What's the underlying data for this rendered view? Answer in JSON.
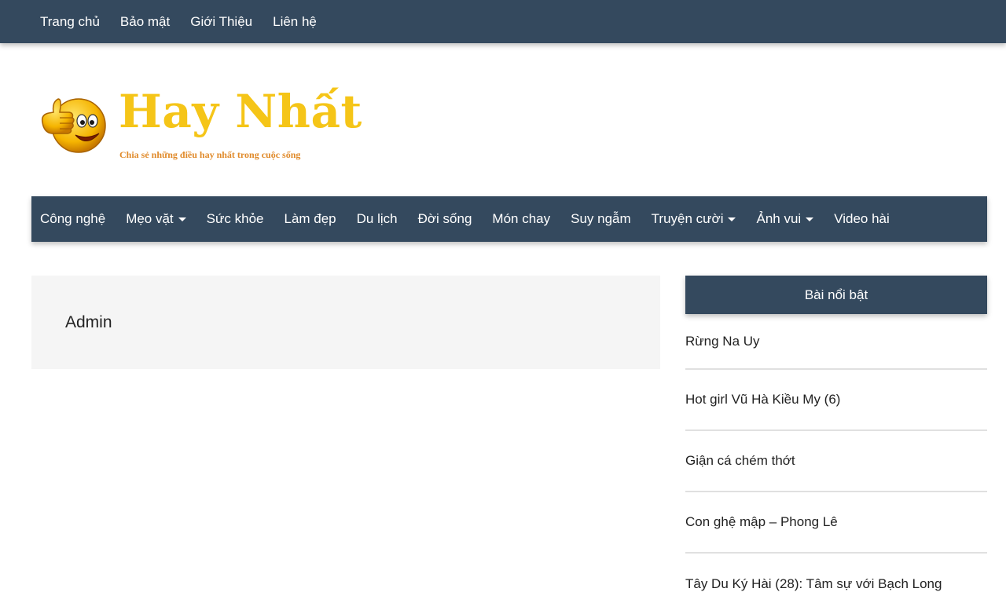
{
  "top_menu": {
    "items": [
      {
        "label": "Trang chủ"
      },
      {
        "label": "Bảo mật"
      },
      {
        "label": "Giới Thiệu"
      },
      {
        "label": "Liên hệ"
      }
    ]
  },
  "logo": {
    "brand": "Hay Nhất",
    "tagline": "Chia sẻ những điều hay nhất trong cuộc sống",
    "icon": "thumbs-up-smiley-icon"
  },
  "main_menu": {
    "items": [
      {
        "label": "Công nghệ",
        "dropdown": false
      },
      {
        "label": "Mẹo vặt",
        "dropdown": true
      },
      {
        "label": "Sức khỏe",
        "dropdown": false
      },
      {
        "label": "Làm đẹp",
        "dropdown": false
      },
      {
        "label": "Du lịch",
        "dropdown": false
      },
      {
        "label": "Đời sống",
        "dropdown": false
      },
      {
        "label": "Món chay",
        "dropdown": false
      },
      {
        "label": "Suy ngẫm",
        "dropdown": false
      },
      {
        "label": "Truyện cười",
        "dropdown": true
      },
      {
        "label": "Ảnh vui",
        "dropdown": true
      },
      {
        "label": "Video hài",
        "dropdown": false
      }
    ]
  },
  "content": {
    "title": "Admin"
  },
  "sidebar": {
    "title": "Bài nổi bật",
    "posts": [
      {
        "title": "Rừng Na Uy"
      },
      {
        "title": "Hot girl Vũ Hà Kiều My (6)"
      },
      {
        "title": "Giận cá chém thớt"
      },
      {
        "title": "Con ghệ mập – Phong Lê"
      },
      {
        "title": "Tây Du Ký Hài (28): Tâm sự với Bạch Long"
      }
    ]
  },
  "colors": {
    "nav_bg": "#34495e",
    "brand_yellow": "#f5c518",
    "tagline_orange": "#e08a2a",
    "content_bg": "#f5f5f5"
  }
}
